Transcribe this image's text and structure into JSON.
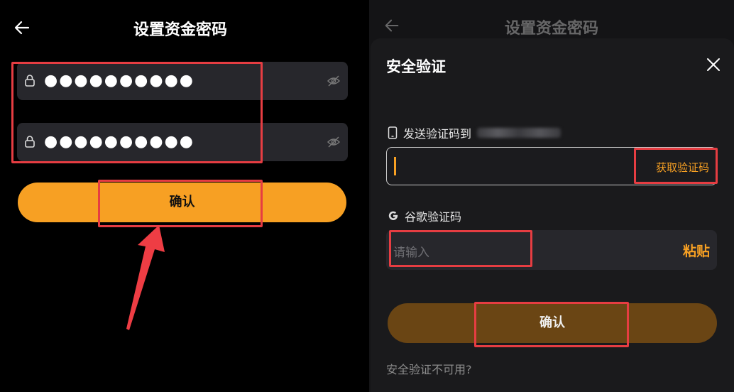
{
  "left": {
    "title": "设置资金密码",
    "password_mask_1": "●●●●●●●●●●",
    "password_mask_2": "●●●●●●●●●●",
    "confirm_label": "确认"
  },
  "right": {
    "title_behind": "设置资金密码",
    "modal_title": "安全验证",
    "send_code_label": "发送验证码到",
    "get_code_label": "获取验证码",
    "google_label": "谷歌验证码",
    "google_placeholder": "请输入",
    "paste_label": "粘贴",
    "confirm_label": "确认",
    "unavailable_link": "安全验证不可用?"
  },
  "colors": {
    "accent": "#f7a023",
    "highlight": "#e63d42",
    "input_bg": "#27272c"
  },
  "icons": [
    "back-arrow-icon",
    "lock-icon",
    "eye-hidden-icon",
    "close-icon",
    "phone-icon",
    "google-icon"
  ]
}
